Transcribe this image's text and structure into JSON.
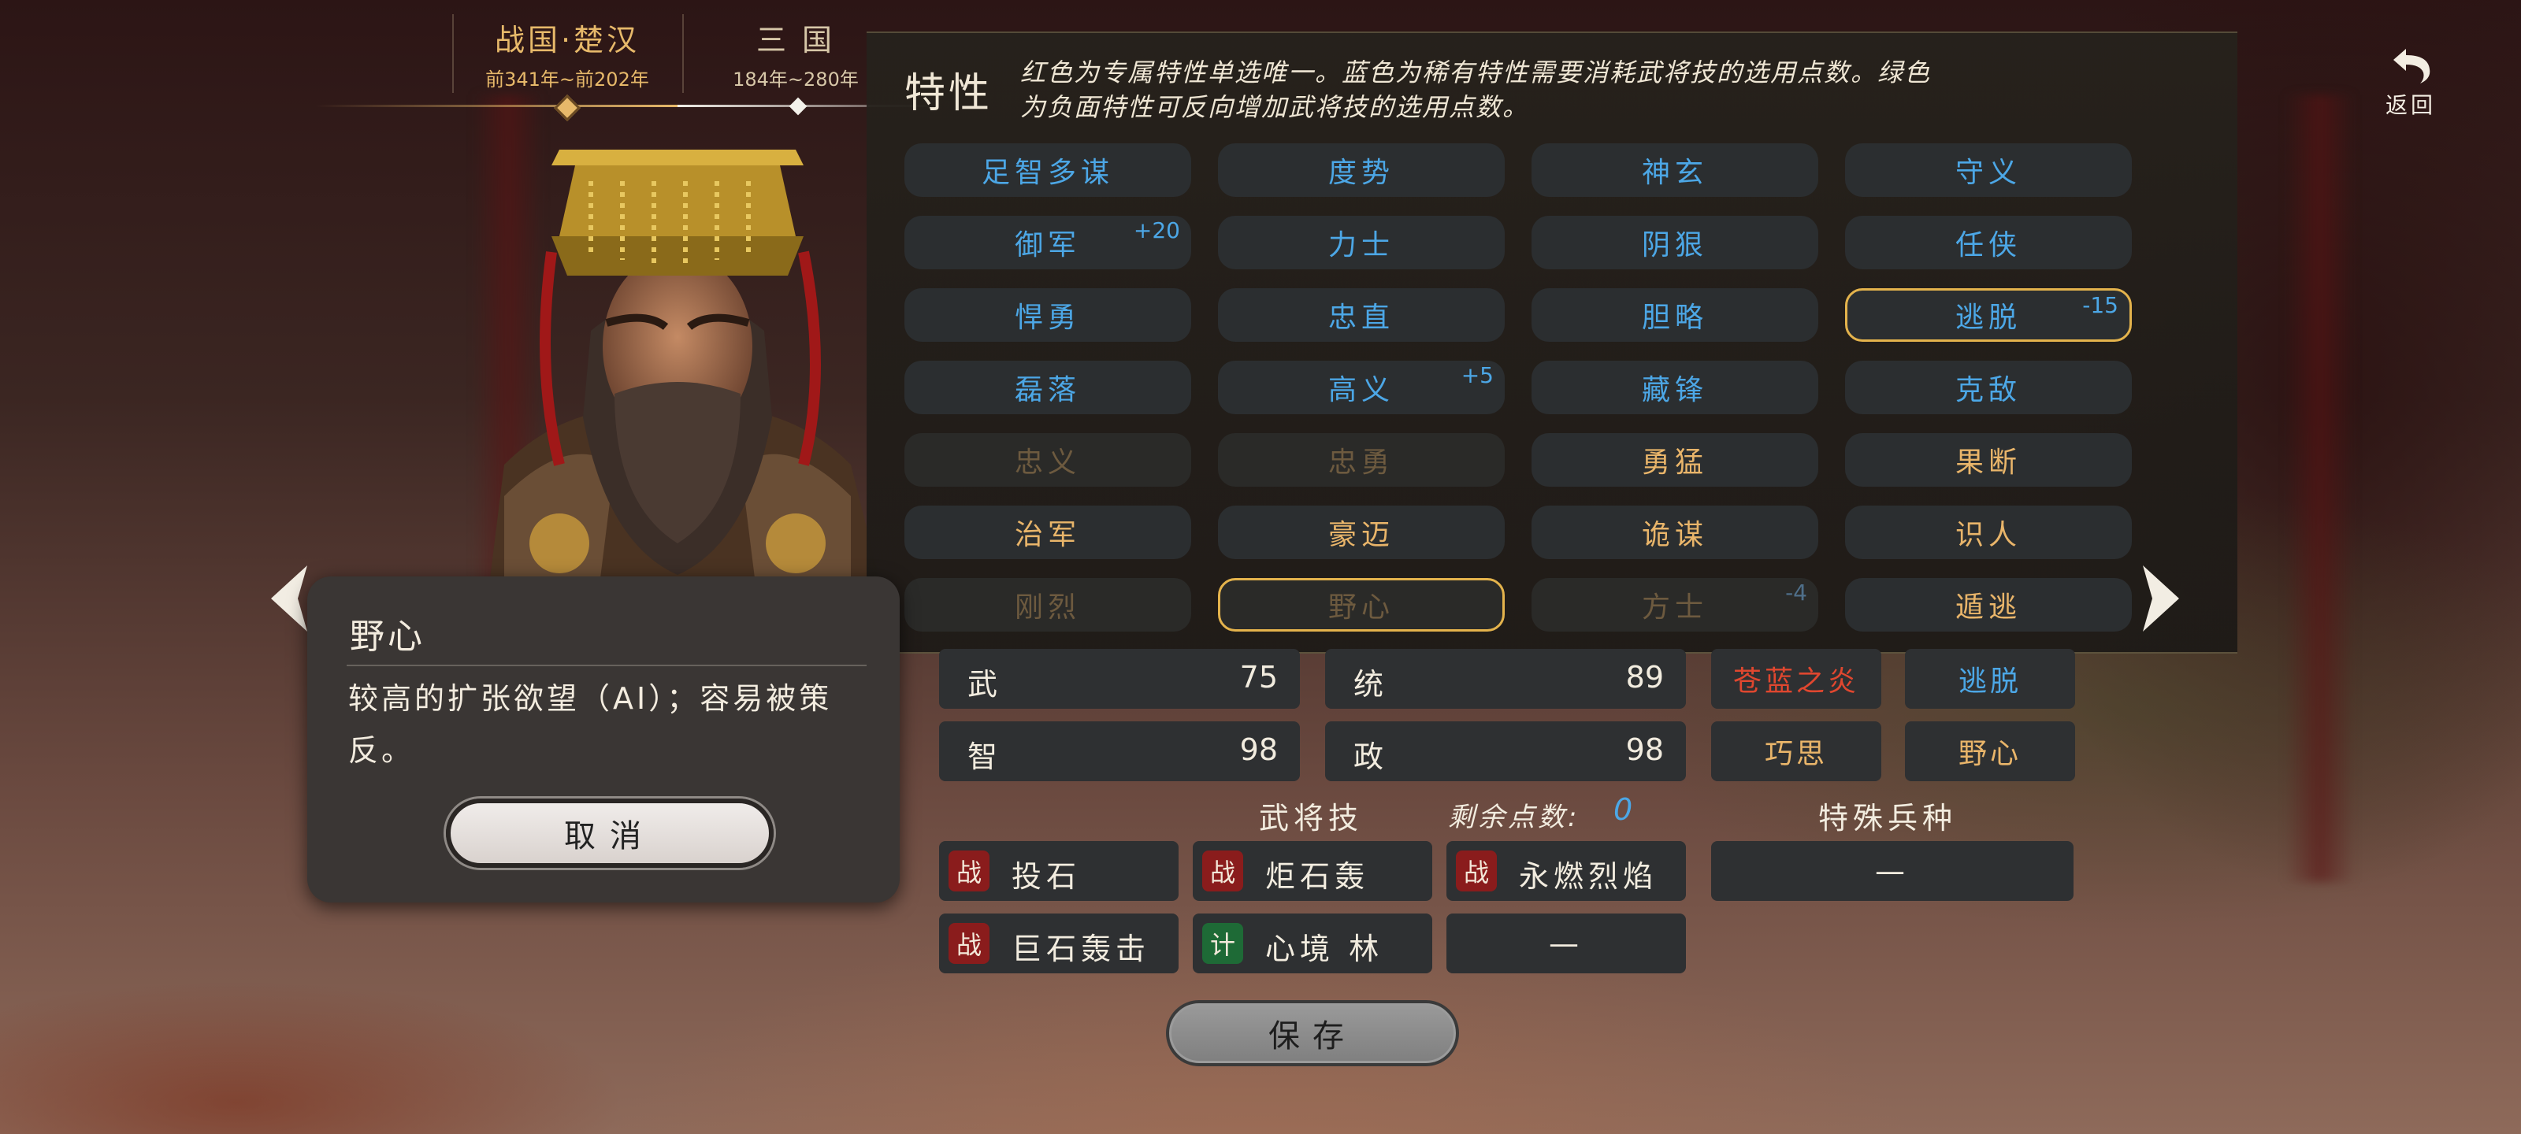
{
  "dynasty_tabs": [
    {
      "name": "战国·楚汉",
      "years": "前341年~前202年",
      "active": true
    },
    {
      "name": "三 国",
      "years": "184年~280年",
      "active": false
    }
  ],
  "back": {
    "label": "返回"
  },
  "traits_panel": {
    "title": "特性",
    "description": "红色为专属特性单选唯一。蓝色为稀有特性需要消耗武将技的选用点数。绿色为负面特性可反向增加武将技的选用点数。",
    "traits": [
      {
        "label": "足智多谋",
        "color": "blue",
        "state": "normal",
        "cost": ""
      },
      {
        "label": "度势",
        "color": "blue",
        "state": "normal",
        "cost": ""
      },
      {
        "label": "神玄",
        "color": "blue",
        "state": "normal",
        "cost": ""
      },
      {
        "label": "守义",
        "color": "blue",
        "state": "normal",
        "cost": ""
      },
      {
        "label": "御军",
        "color": "blue",
        "state": "normal",
        "cost": "+20"
      },
      {
        "label": "力士",
        "color": "blue",
        "state": "normal",
        "cost": ""
      },
      {
        "label": "阴狠",
        "color": "blue",
        "state": "normal",
        "cost": ""
      },
      {
        "label": "任侠",
        "color": "blue",
        "state": "normal",
        "cost": ""
      },
      {
        "label": "悍勇",
        "color": "blue",
        "state": "normal",
        "cost": ""
      },
      {
        "label": "忠直",
        "color": "blue",
        "state": "normal",
        "cost": ""
      },
      {
        "label": "胆略",
        "color": "blue",
        "state": "normal",
        "cost": ""
      },
      {
        "label": "逃脱",
        "color": "blue",
        "state": "selected",
        "cost": "-15"
      },
      {
        "label": "磊落",
        "color": "blue",
        "state": "normal",
        "cost": ""
      },
      {
        "label": "高义",
        "color": "blue",
        "state": "normal",
        "cost": "+5"
      },
      {
        "label": "藏锋",
        "color": "blue",
        "state": "normal",
        "cost": ""
      },
      {
        "label": "克敌",
        "color": "blue",
        "state": "normal",
        "cost": ""
      },
      {
        "label": "忠义",
        "color": "gold",
        "state": "disabled",
        "cost": ""
      },
      {
        "label": "忠勇",
        "color": "gold",
        "state": "disabled",
        "cost": ""
      },
      {
        "label": "勇猛",
        "color": "gold",
        "state": "normal",
        "cost": ""
      },
      {
        "label": "果断",
        "color": "gold",
        "state": "normal",
        "cost": ""
      },
      {
        "label": "治军",
        "color": "gold",
        "state": "normal",
        "cost": ""
      },
      {
        "label": "豪迈",
        "color": "gold",
        "state": "normal",
        "cost": ""
      },
      {
        "label": "诡谋",
        "color": "gold",
        "state": "normal",
        "cost": ""
      },
      {
        "label": "识人",
        "color": "gold",
        "state": "normal",
        "cost": ""
      },
      {
        "label": "刚烈",
        "color": "gold",
        "state": "disabled",
        "cost": ""
      },
      {
        "label": "野心",
        "color": "gold",
        "state": "disabled-selected",
        "cost": ""
      },
      {
        "label": "方士",
        "color": "gold",
        "state": "disabled",
        "cost": "-4"
      },
      {
        "label": "遁逃",
        "color": "gold",
        "state": "normal",
        "cost": ""
      }
    ]
  },
  "stats": [
    {
      "label": "武",
      "value": "75"
    },
    {
      "label": "统",
      "value": "89"
    },
    {
      "label": "智",
      "value": "98"
    },
    {
      "label": "政",
      "value": "98"
    }
  ],
  "current_traits": [
    {
      "label": "苍蓝之炎",
      "color": "#e0472f"
    },
    {
      "label": "逃脱",
      "color": "#4ca7e6"
    },
    {
      "label": "巧思",
      "color": "#e9b56a"
    },
    {
      "label": "野心",
      "color": "#e9b56a"
    }
  ],
  "skills_section": {
    "title": "武将技",
    "points_label": "剩余点数:",
    "points_value": "0",
    "special_troops_title": "特殊兵种",
    "skills": [
      {
        "badge": "战",
        "type": "war",
        "name": "投石"
      },
      {
        "badge": "战",
        "type": "war",
        "name": "炬石轰"
      },
      {
        "badge": "战",
        "type": "war",
        "name": "永燃烈焰"
      },
      {
        "badge": "战",
        "type": "war",
        "name": "巨石轰击"
      },
      {
        "badge": "计",
        "type": "plan",
        "name": "心境 林"
      },
      {
        "badge": "",
        "type": "empty",
        "name": "—"
      }
    ],
    "special_troop": "—"
  },
  "save": {
    "label": "保存"
  },
  "popup": {
    "title": "野心",
    "body": "较高的扩张欲望（AI）；容易被策反。",
    "cancel_label": "取消"
  },
  "colors": {
    "blue": "#4ca7e6",
    "gold": "#e9b56a",
    "selected_border": "#e4b34c"
  }
}
